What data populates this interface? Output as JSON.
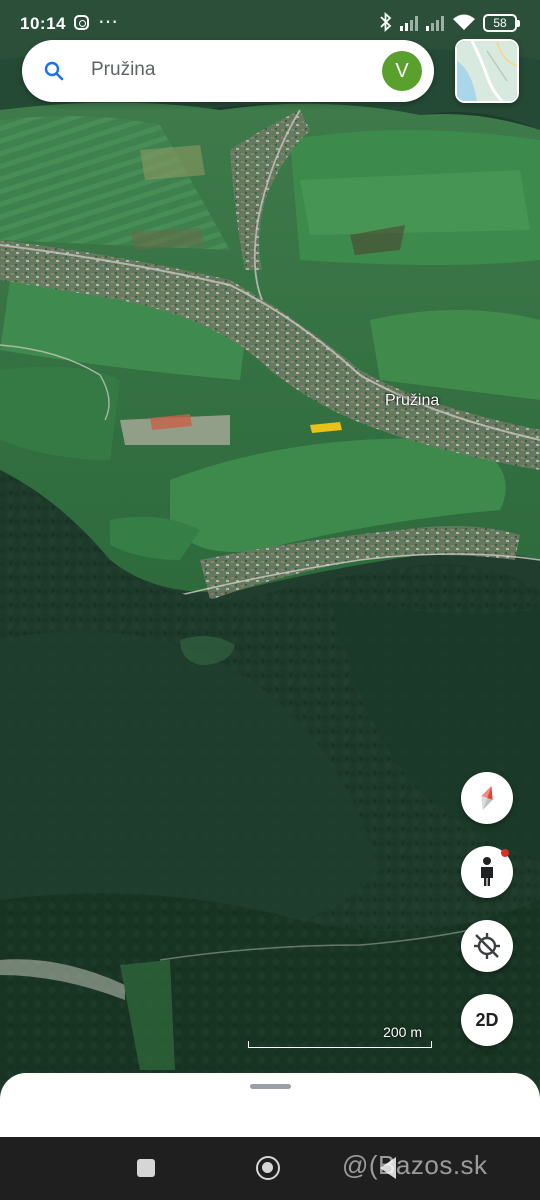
{
  "status_bar": {
    "time": "10:14",
    "battery": "58",
    "icons": [
      "instagram-icon",
      "more-icon",
      "bluetooth-icon",
      "signal-icon",
      "signal-icon",
      "wifi-icon",
      "battery-icon"
    ]
  },
  "search": {
    "query": "Pružina",
    "icon": "search-icon",
    "avatar_initial": "V",
    "avatar_color": "#5aa02c"
  },
  "map": {
    "type": "satellite-3d",
    "place_label": "Pružina",
    "scale_label": "200 m"
  },
  "controls": {
    "compass": "compass-icon",
    "street_view": "pegman-icon",
    "location": "location-off-icon",
    "view_mode_label": "2D"
  },
  "watermark": "@(Bazos.sk"
}
